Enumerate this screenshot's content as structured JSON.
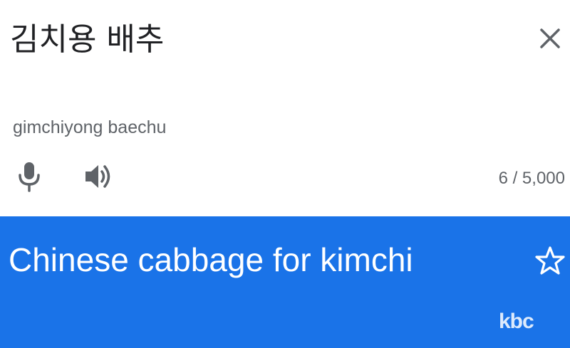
{
  "source": {
    "text": "김치용 배추",
    "romanization": "gimchiyong baechu",
    "char_count": "6 / 5,000",
    "icons": {
      "close": "close-icon",
      "mic": "microphone-icon",
      "speaker": "speaker-icon"
    }
  },
  "target": {
    "text": "Chinese cabbage for kimchi",
    "icons": {
      "star": "star-outline-icon"
    }
  },
  "watermark": {
    "text": "kbc"
  },
  "colors": {
    "target_background": "#1a73e8",
    "source_text": "#202124",
    "secondary_text": "#5f6368",
    "icon": "#5f6368"
  }
}
